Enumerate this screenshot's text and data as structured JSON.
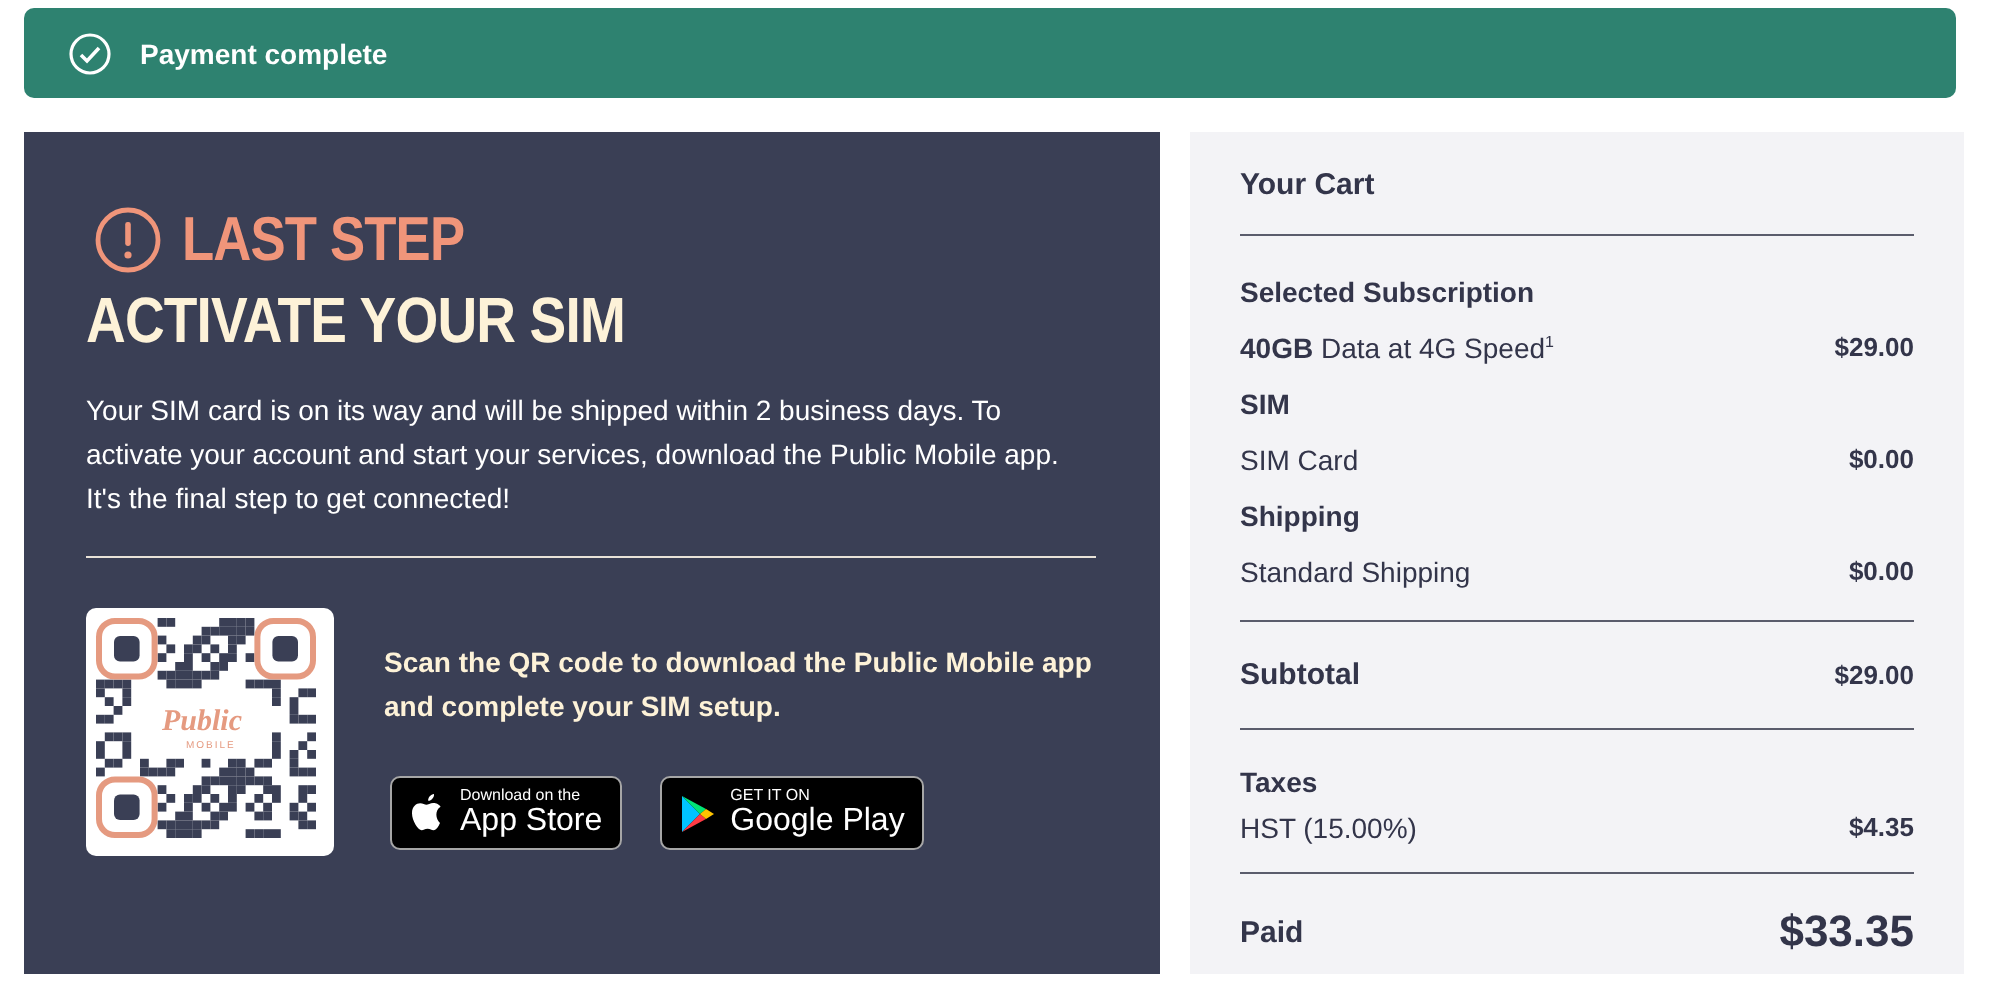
{
  "banner": {
    "message": "Payment complete"
  },
  "activation": {
    "eyebrow": "LAST STEP",
    "title": "ACTIVATE YOUR SIM",
    "body": "Your SIM card is on its way and will be shipped within 2 business days. To activate your account and start your services, download the Public Mobile app. It's the final step to get connected!",
    "qr": {
      "logo_title": "Public",
      "logo_subtitle": "MOBILE"
    },
    "scan_text": "Scan the QR code to download the Public Mobile app and complete your SIM setup.",
    "store_buttons": [
      {
        "kind": "apple",
        "small": "Download on the",
        "large": "App Store"
      },
      {
        "kind": "google",
        "small": "GET IT ON",
        "large": "Google Play"
      }
    ]
  },
  "cart": {
    "title": "Your Cart",
    "groups": [
      {
        "heading": "Selected Subscription",
        "items": [
          {
            "label": "**40GB** Data at 4G Speed$^{1}$",
            "price": "$29.00"
          }
        ]
      },
      {
        "heading": "SIM",
        "items": [
          {
            "label": "SIM Card",
            "price": "$0.00"
          }
        ]
      },
      {
        "heading": "Shipping",
        "items": [
          {
            "label": "Standard Shipping",
            "price": "$0.00"
          }
        ]
      }
    ],
    "subtotal": {
      "label": "Subtotal",
      "amount": "$29.00"
    },
    "taxes": {
      "heading": "Taxes",
      "items": [
        {
          "label": "HST (15.00%)",
          "price": "$4.35"
        }
      ]
    },
    "paid": {
      "label": "Paid",
      "amount": "$33.35"
    }
  }
}
